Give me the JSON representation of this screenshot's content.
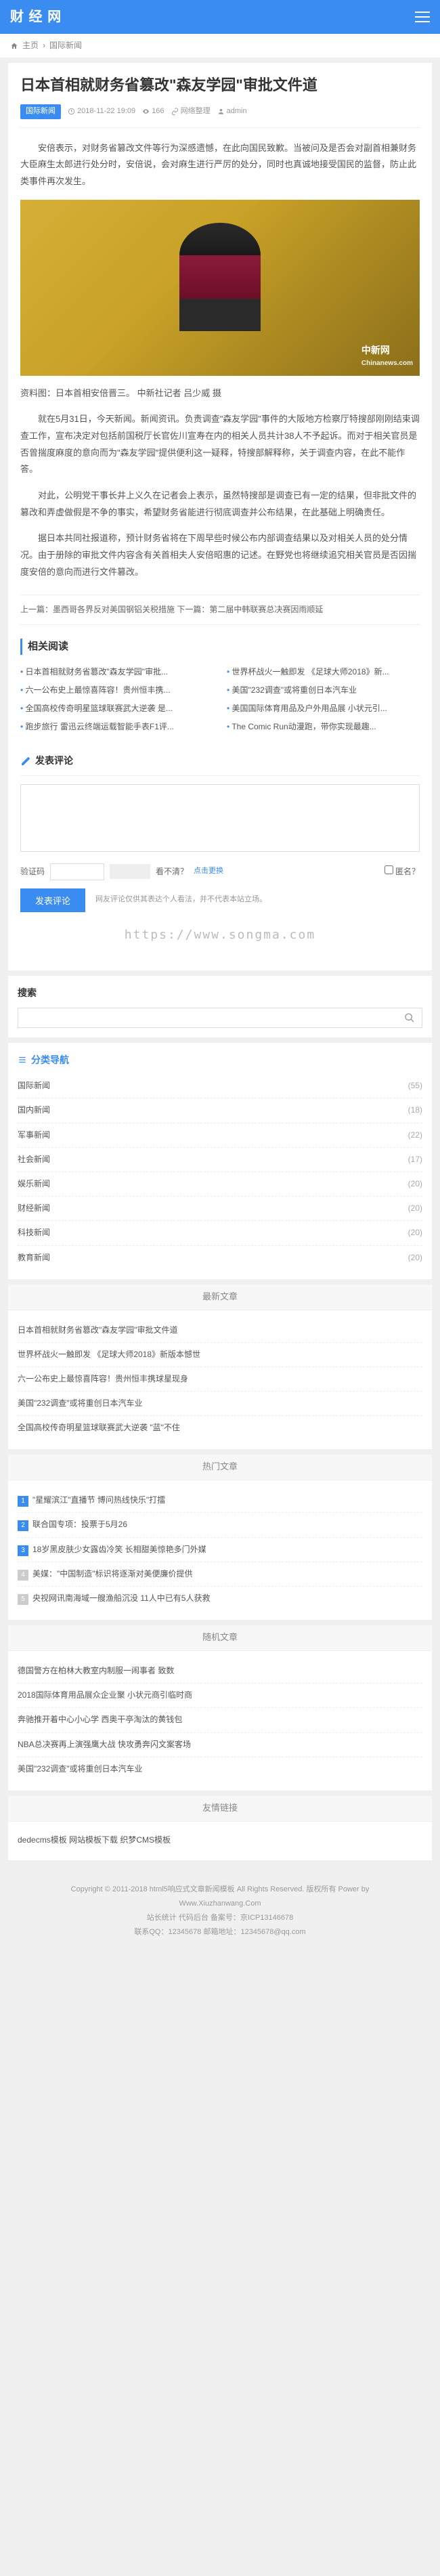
{
  "header": {
    "logo": "财 经 网"
  },
  "breadcrumb": {
    "home": "主页",
    "cat": "国际新闻"
  },
  "article": {
    "title": "日本首相就财务省篡改\"森友学园\"审批文件道",
    "category": "国际新闻",
    "date": "2018-11-22 19:09",
    "views": "166",
    "source": "网络整理",
    "author": "admin",
    "p1": "安倍表示，对财务省篡改文件等行为深感遗憾，在此向国民致歉。当被问及是否会对副首相兼财务大臣麻生太郎进行处分时，安倍说，会对麻生进行严厉的处分，同时也真诚地接受国民的监督，防止此类事件再次发生。",
    "caption": "资料图：日本首相安倍晋三。 中新社记者 吕少威 摄",
    "p2": "就在5月31日，今天新闻。新闻资讯。负责调查\"森友学园\"事件的大阪地方检察厅特搜部刚刚结束调查工作，宣布决定对包括前国税厅长官佐川宣寿在内的相关人员共计38人不予起诉。而对于相关官员是否曾揣度麻度的意向而为\"森友学园\"提供便利这一疑释，特搜部解释称，关于调查内容，在此不能作答。",
    "p3": "对此，公明党干事长井上义久在记者会上表示，虽然特搜部是调查已有一定的结果，但非批文件的篡改和弄虚做假是不争的事实，希望财务省能进行彻底调查并公布结果，在此基础上明确责任。",
    "p4": "据日本共同社报道称，预计财务省将在下周早些时候公布内部调查结果以及对相关人员的处分情况。由于册除的审批文件内容含有关首相夫人安倍昭惠的记述。在野党也将继续追究相关官员是否因揣度安倍的意向而进行文件篡改。",
    "watermark": "中新网",
    "watermark_url": "Chinanews.com"
  },
  "prevnext": "上一篇：墨西哥各界反对美国钢铝关税措施 下一篇：第二届中韩联赛总决赛因雨顺延",
  "related": {
    "title": "相关阅读",
    "rows": [
      [
        "日本首相就财务省篡改\"森友学园\"审批...",
        "世界杯战火一触即发 《足球大师2018》新..."
      ],
      [
        "六一公布史上最惊喜阵容！贵州恒丰携...",
        "美国\"232调查\"或将重创日本汽车业"
      ],
      [
        "全国高校传奇明星篮球联赛武大逆袭 是...",
        "美国国际体育用品及户外用品展 小状元引..."
      ],
      [
        "跑步旅行 雷迅云终端运载智能手表F1评...",
        "The Comic Run动漫跑，带你实现最趣..."
      ]
    ]
  },
  "comment": {
    "title": "发表评论",
    "captcha_label": "验证码",
    "unclear": "看不清？",
    "refresh": "点击更换",
    "anon": "匿名？",
    "submit": "发表评论",
    "note": "网友评论仅供其表达个人看法，并不代表本站立场。"
  },
  "url_watermark": "https://www.songma.com",
  "search": {
    "title": "搜索",
    "placeholder": ""
  },
  "categories": {
    "title": "分类导航",
    "items": [
      {
        "name": "国际新闻",
        "count": "(55)"
      },
      {
        "name": "国内新闻",
        "count": "(18)"
      },
      {
        "name": "军事新闻",
        "count": "(22)"
      },
      {
        "name": "社会新闻",
        "count": "(17)"
      },
      {
        "name": "娱乐新闻",
        "count": "(20)"
      },
      {
        "name": "财经新闻",
        "count": "(20)"
      },
      {
        "name": "科技新闻",
        "count": "(20)"
      },
      {
        "name": "教育新闻",
        "count": "(20)"
      }
    ]
  },
  "latest": {
    "title": "最新文章",
    "items": [
      "日本首相就财务省篡改\"森友学园\"审批文件道",
      "世界杯战火一触即发 《足球大师2018》新版本憾世",
      "六一公布史上最惊喜阵容！贵州恒丰携球星现身",
      "美国\"232调查\"或将重创日本汽车业",
      "全国高校传奇明星篮球联赛武大逆袭 \"蓝\"不住"
    ]
  },
  "hot": {
    "title": "热门文章",
    "items": [
      "\"星耀滨江\"直播节 博问热线快乐\"打擂",
      "联合国专项：投票于5月26",
      "18岁黑皮肤少女露齿冷笑 长相甜美惊艳多门外媒",
      "美媒：\"中国制造\"标识将逐渐对美便廉价提供",
      "央视网讯南海域一艘渔船沉没 11人中已有5人获救"
    ]
  },
  "random": {
    "title": "随机文章",
    "items": [
      "德国警方在柏林大教室内制服一闹事者 致数",
      "2018国际体育用品展众企业聚 小状元商引临时商",
      "奔驰推开着中心小心学 西奥干亭淘汰的黄钱包",
      "NBA总决赛再上演强鹰大战 快攻勇奔闪文案客场",
      "美国\"232调查\"或将重创日本汽车业"
    ]
  },
  "friendlinks": {
    "title": "友情链接",
    "text": "dedecms模板 网站模板下载 织梦CMS模板"
  },
  "footer": {
    "l1": "Copyright © 2011-2018 html5响应式文章新闻模板 All Rights Reserved. 版权所有 Power by",
    "l2": "Www.Xiuzhanwang.Com",
    "l3": "站长统计 代码后台 备案号：京ICP13146678",
    "l4": "联系QQ：12345678 邮箱地址：12345678@qq.com"
  }
}
